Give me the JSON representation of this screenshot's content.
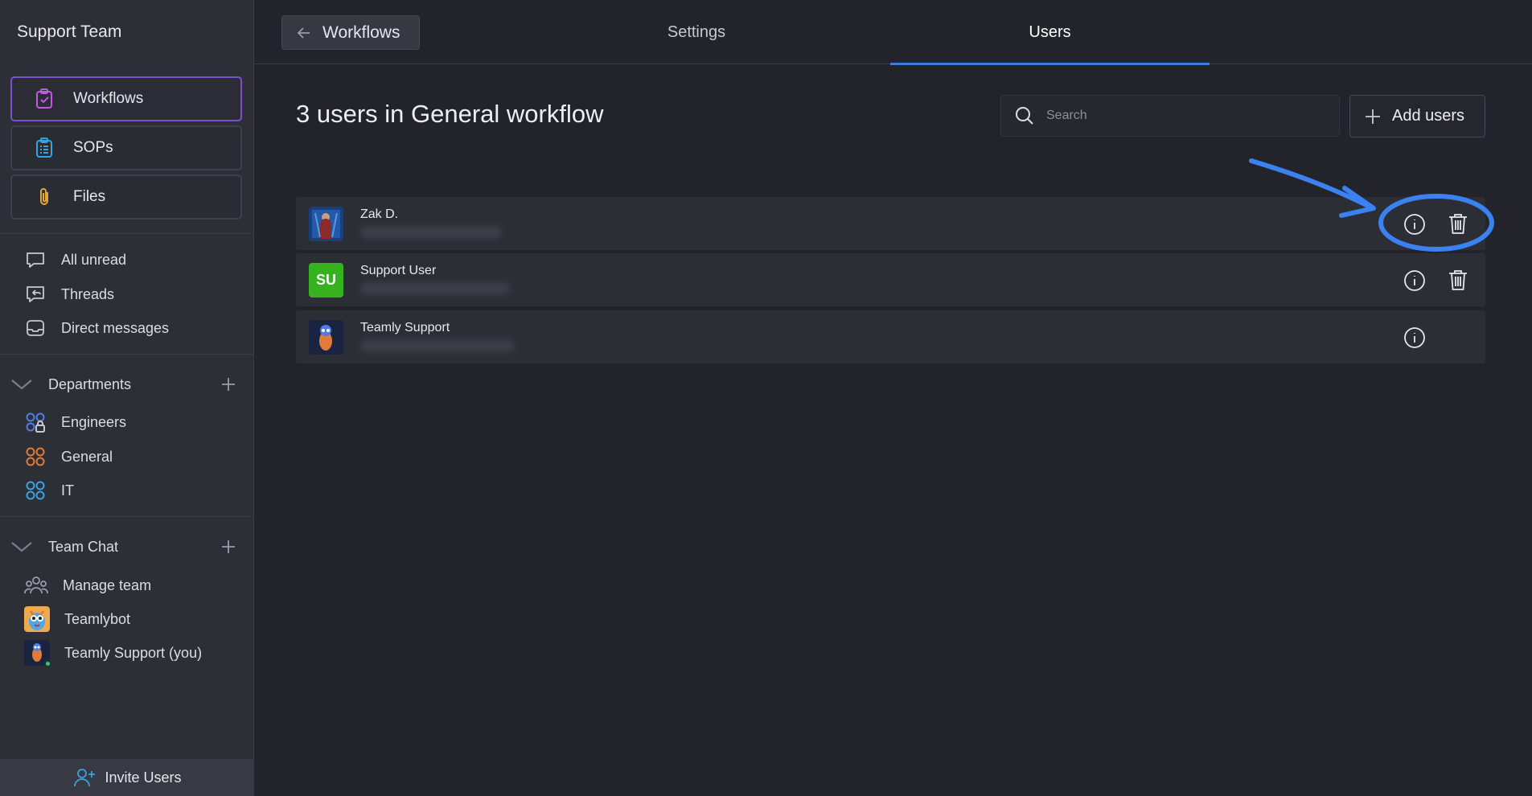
{
  "sidebar": {
    "team_name": "Support Team",
    "nav": [
      {
        "label": "Workflows",
        "icon": "clipboard-check-icon",
        "active": true
      },
      {
        "label": "SOPs",
        "icon": "clipboard-list-icon"
      },
      {
        "label": "Files",
        "icon": "paperclip-icon"
      }
    ],
    "items": [
      {
        "label": "All unread",
        "icon": "chat-bubble-icon"
      },
      {
        "label": "Threads",
        "icon": "threads-icon"
      },
      {
        "label": "Direct messages",
        "icon": "inbox-icon"
      }
    ],
    "departments": {
      "title": "Departments",
      "items": [
        {
          "label": "Engineers",
          "icon": "department-locked-icon",
          "color": "#4d7ee8"
        },
        {
          "label": "General",
          "icon": "department-icon",
          "color": "#e07b3a"
        },
        {
          "label": "IT",
          "icon": "department-icon",
          "color": "#3aa2e0"
        }
      ]
    },
    "team_chat": {
      "title": "Team Chat",
      "items": [
        {
          "label": "Manage team",
          "icon": "team-icon"
        },
        {
          "label": "Teamlybot",
          "icon": "teamlybot-avatar"
        },
        {
          "label": "Teamly Support (you)",
          "icon": "teamly-support-avatar"
        }
      ]
    },
    "invite_label": "Invite Users"
  },
  "header": {
    "back_label": "Workflows",
    "tabs": [
      {
        "label": "Settings",
        "active": false
      },
      {
        "label": "Users",
        "active": true
      }
    ]
  },
  "main": {
    "title": "3 users in General workflow",
    "search_placeholder": "Search",
    "add_users_label": "Add users",
    "users": [
      {
        "name": "Zak D.",
        "avatar": "photo",
        "can_delete": true
      },
      {
        "name": "Support User",
        "avatar_initials": "SU",
        "avatar_color": "#35b21e",
        "can_delete": true
      },
      {
        "name": "Teamly Support",
        "avatar": "photo",
        "can_delete": false
      }
    ]
  },
  "colors": {
    "accent": "#3c7be0",
    "active_border": "#7b4fd0",
    "annotation": "#3a82f0"
  }
}
